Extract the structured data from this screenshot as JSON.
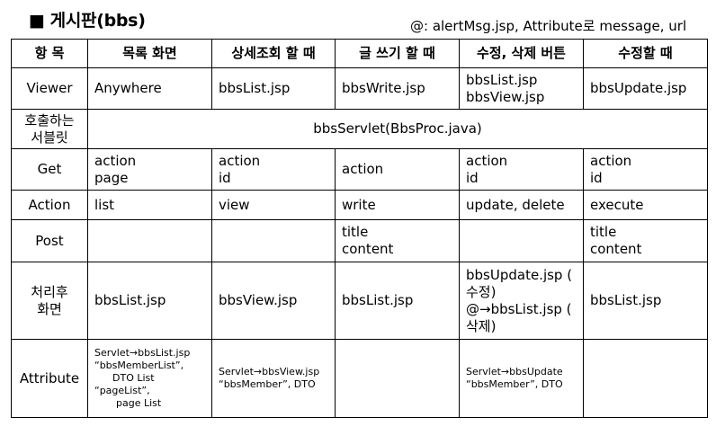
{
  "header": {
    "bullet": "■",
    "title": "게시판(bbs)",
    "note": "@: alertMsg.jsp, Attribute로 message, url"
  },
  "columns": [
    "항 목",
    "목록 화면",
    "상세조회 할 때",
    "글 쓰기 할 때",
    "수정, 삭제 버튼",
    "수정할 때"
  ],
  "rows": {
    "viewer": {
      "label": "Viewer",
      "cells": [
        "Anywhere",
        "bbsList.jsp",
        "bbsWrite.jsp",
        [
          "bbsList.jsp",
          "bbsView.jsp"
        ],
        "bbsUpdate.jsp"
      ]
    },
    "servlet": {
      "label": [
        "호출하는",
        "서블릿"
      ],
      "value": "bbsServlet(BbsProc.java)"
    },
    "get": {
      "label": "Get",
      "cells": [
        [
          "action",
          "page"
        ],
        [
          "action",
          "id"
        ],
        "action",
        [
          "action",
          "id"
        ],
        [
          "action",
          "id"
        ]
      ]
    },
    "action": {
      "label": "Action",
      "cells": [
        "list",
        "view",
        "write",
        "update, delete",
        "execute"
      ]
    },
    "post": {
      "label": "Post",
      "cells": [
        "",
        "",
        [
          "title",
          "content"
        ],
        "",
        [
          "title",
          "content"
        ]
      ]
    },
    "after": {
      "label": [
        "처리후",
        "화면"
      ],
      "cells": [
        "bbsList.jsp",
        "bbsView.jsp",
        "bbsList.jsp",
        [
          "bbsUpdate.jsp (",
          "수정)",
          "@→bbsList.jsp (",
          "삭제)"
        ],
        "bbsList.jsp"
      ]
    },
    "attribute": {
      "label": "Attribute",
      "cells": [
        [
          "Servlet→bbsList.jsp",
          "“bbsMemberList”,",
          "DTO List",
          "“pageList”,",
          "page List"
        ],
        [
          "Servlet→bbsView.jsp",
          "“bbsMember”, DTO"
        ],
        [],
        [
          "Servlet→bbsUpdate",
          "“bbsMember”, DTO"
        ],
        []
      ]
    }
  }
}
